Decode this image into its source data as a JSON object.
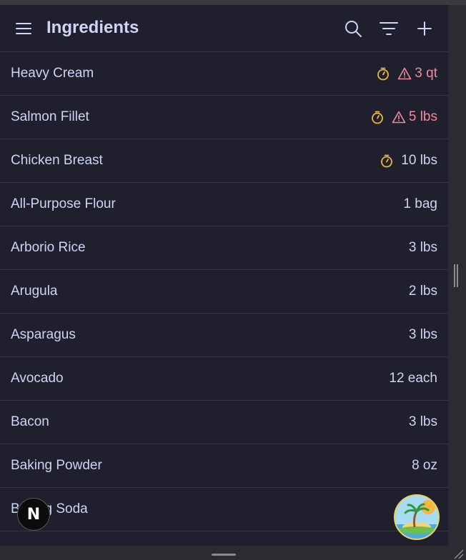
{
  "header": {
    "title": "Ingredients"
  },
  "colors": {
    "accent_timer": "#e9b73a",
    "warn": "#f08aa0",
    "text": "#cdd5f2",
    "bg": "#1f1f2e"
  },
  "items": [
    {
      "name": "Heavy Cream",
      "qty": "3 qt",
      "timer": true,
      "warning": true
    },
    {
      "name": "Salmon Fillet",
      "qty": "5 lbs",
      "timer": true,
      "warning": true
    },
    {
      "name": "Chicken Breast",
      "qty": "10 lbs",
      "timer": true,
      "warning": false
    },
    {
      "name": "All-Purpose Flour",
      "qty": "1 bag",
      "timer": false,
      "warning": false
    },
    {
      "name": "Arborio Rice",
      "qty": "3 lbs",
      "timer": false,
      "warning": false
    },
    {
      "name": "Arugula",
      "qty": "2 lbs",
      "timer": false,
      "warning": false
    },
    {
      "name": "Asparagus",
      "qty": "3 lbs",
      "timer": false,
      "warning": false
    },
    {
      "name": "Avocado",
      "qty": "12 each",
      "timer": false,
      "warning": false
    },
    {
      "name": "Bacon",
      "qty": "3 lbs",
      "timer": false,
      "warning": false
    },
    {
      "name": "Baking Powder",
      "qty": "8 oz",
      "timer": false,
      "warning": false
    },
    {
      "name": "Baking Soda",
      "qty": "",
      "timer": false,
      "warning": false
    }
  ],
  "badge": {
    "letter": "N"
  },
  "icons": [
    "menu-icon",
    "search-icon",
    "filter-icon",
    "plus-icon",
    "timer-icon",
    "warning-icon"
  ]
}
